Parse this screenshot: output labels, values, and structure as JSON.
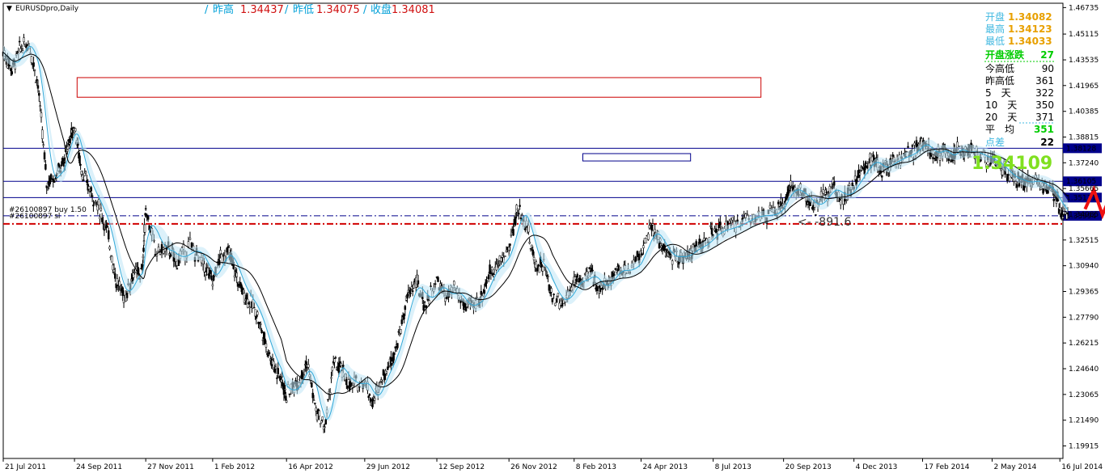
{
  "window": {
    "title": "EURUSDpro,Daily"
  },
  "header": {
    "sep": "/",
    "items": [
      {
        "label": "昨高",
        "value": "1.34437"
      },
      {
        "label": "昨低",
        "value": "1.34075"
      },
      {
        "label": "收盘",
        "value": "1.34081"
      }
    ],
    "label_color": "#00a0d8",
    "value_color": "#d01010"
  },
  "panel": {
    "ohl": [
      {
        "label": "开盘",
        "value": "1.34082"
      },
      {
        "label": "最高",
        "value": "1.34123"
      },
      {
        "label": "最低",
        "value": "1.34033"
      }
    ],
    "change": {
      "label": "开盘涨跌",
      "value": "27"
    },
    "stats": [
      {
        "label": "今高低",
        "value": "90"
      },
      {
        "label": "昨高低",
        "value": "361"
      },
      {
        "label": "5　天",
        "value": "322"
      },
      {
        "label": "10　天",
        "value": "350"
      },
      {
        "label": "20　天",
        "value": "371"
      }
    ],
    "avg": {
      "label": "平　均",
      "value": "351"
    },
    "spread": {
      "label": "点差",
      "value": "22"
    },
    "current_price": "1.34109",
    "colors": {
      "label_blue": "#40b8e0",
      "value_orange": "#e8a000",
      "green": "#00cc00",
      "current": "#80e020"
    }
  },
  "annotations": {
    "line_label_1": "#26100897 buy 1.50",
    "line_label_2": "#26100897 sl",
    "distance_text": "<- -891.6"
  },
  "chart_data": {
    "type": "candlestick",
    "symbol": "EURUSDpro",
    "timeframe": "Daily",
    "ylim": [
      1.1915,
      1.47
    ],
    "y_ticks": [
      "1.46735",
      "1.45115",
      "1.43535",
      "1.41965",
      "1.40385",
      "1.38815",
      "1.37240",
      "1.35665",
      "1.34085",
      "1.32515",
      "1.30940",
      "1.29365",
      "1.27790",
      "1.26215",
      "1.24640",
      "1.23065",
      "1.21490",
      "1.19915"
    ],
    "y_ticks_val": [
      1.46735,
      1.45115,
      1.43535,
      1.41965,
      1.40385,
      1.38815,
      1.3724,
      1.35665,
      1.34085,
      1.32515,
      1.3094,
      1.29365,
      1.2779,
      1.26215,
      1.2464,
      1.23065,
      1.2149,
      1.19915
    ],
    "x_labels": [
      "21 Jul 2011",
      "24 Sep 2011",
      "27 Nov 2011",
      "1 Feb 2012",
      "16 Apr 2012",
      "29 Jun 2012",
      "12 Sep 2012",
      "26 Nov 2012",
      "8 Feb 2013",
      "24 Apr 2013",
      "8 Jul 2013",
      "20 Sep 2013",
      "4 Dec 2013",
      "17 Feb 2014",
      "2 May 2014",
      "16 Jul 2014"
    ],
    "x_labels_pos": [
      0.0,
      0.082,
      0.164,
      0.241,
      0.326,
      0.416,
      0.499,
      0.582,
      0.657,
      0.734,
      0.817,
      0.898,
      0.979,
      1.058,
      1.138,
      1.216
    ],
    "horizontal_lines": [
      {
        "value": 1.38128,
        "label": "1.38128",
        "color": "#00008b",
        "style": "solid"
      },
      {
        "value": 1.36105,
        "label": "1.36105",
        "color": "#00008b",
        "style": "solid"
      },
      {
        "value": 1.35111,
        "label": "1.35111",
        "color": "#00008b",
        "style": "solid"
      },
      {
        "value": 1.33994,
        "label": "1.33994",
        "color": "#00008b",
        "style": "dashdot"
      },
      {
        "value": 1.335,
        "label": "",
        "color": "#d00000",
        "style": "dashdot"
      }
    ],
    "rectangles": [
      {
        "x0": 0.085,
        "x1": 0.872,
        "y0": 1.4245,
        "y1": 1.4125,
        "color": "#cc0000"
      },
      {
        "x0": 0.667,
        "x1": 0.791,
        "y0": 1.378,
        "y1": 1.3735,
        "color": "#00008b"
      }
    ],
    "price_path": [
      [
        0.0,
        1.44
      ],
      [
        0.01,
        1.43
      ],
      [
        0.02,
        1.443
      ],
      [
        0.03,
        1.445
      ],
      [
        0.04,
        1.42
      ],
      [
        0.05,
        1.36
      ],
      [
        0.06,
        1.365
      ],
      [
        0.07,
        1.372
      ],
      [
        0.075,
        1.385
      ],
      [
        0.082,
        1.395
      ],
      [
        0.09,
        1.368
      ],
      [
        0.1,
        1.355
      ],
      [
        0.11,
        1.345
      ],
      [
        0.12,
        1.33
      ],
      [
        0.13,
        1.3
      ],
      [
        0.14,
        1.29
      ],
      [
        0.15,
        1.305
      ],
      [
        0.16,
        1.305
      ],
      [
        0.164,
        1.345
      ],
      [
        0.175,
        1.318
      ],
      [
        0.19,
        1.32
      ],
      [
        0.2,
        1.312
      ],
      [
        0.215,
        1.322
      ],
      [
        0.23,
        1.31
      ],
      [
        0.241,
        1.3
      ],
      [
        0.25,
        1.315
      ],
      [
        0.26,
        1.317
      ],
      [
        0.27,
        1.3
      ],
      [
        0.28,
        1.29
      ],
      [
        0.29,
        1.283
      ],
      [
        0.3,
        1.265
      ],
      [
        0.31,
        1.25
      ],
      [
        0.32,
        1.24
      ],
      [
        0.326,
        1.23
      ],
      [
        0.34,
        1.24
      ],
      [
        0.35,
        1.25
      ],
      [
        0.36,
        1.22
      ],
      [
        0.37,
        1.21
      ],
      [
        0.38,
        1.25
      ],
      [
        0.39,
        1.245
      ],
      [
        0.4,
        1.235
      ],
      [
        0.416,
        1.24
      ],
      [
        0.425,
        1.225
      ],
      [
        0.435,
        1.24
      ],
      [
        0.445,
        1.25
      ],
      [
        0.455,
        1.265
      ],
      [
        0.465,
        1.29
      ],
      [
        0.475,
        1.3
      ],
      [
        0.485,
        1.285
      ],
      [
        0.499,
        1.3
      ],
      [
        0.51,
        1.29
      ],
      [
        0.52,
        1.295
      ],
      [
        0.53,
        1.285
      ],
      [
        0.54,
        1.285
      ],
      [
        0.55,
        1.29
      ],
      [
        0.56,
        1.305
      ],
      [
        0.57,
        1.31
      ],
      [
        0.582,
        1.32
      ],
      [
        0.592,
        1.345
      ],
      [
        0.602,
        1.335
      ],
      [
        0.612,
        1.31
      ],
      [
        0.622,
        1.31
      ],
      [
        0.632,
        1.29
      ],
      [
        0.645,
        1.287
      ],
      [
        0.657,
        1.3
      ],
      [
        0.667,
        1.3
      ],
      [
        0.677,
        1.305
      ],
      [
        0.687,
        1.295
      ],
      [
        0.697,
        1.3
      ],
      [
        0.707,
        1.308
      ],
      [
        0.717,
        1.305
      ],
      [
        0.734,
        1.318
      ],
      [
        0.745,
        1.332
      ],
      [
        0.755,
        1.325
      ],
      [
        0.765,
        1.315
      ],
      [
        0.775,
        1.315
      ],
      [
        0.785,
        1.315
      ],
      [
        0.795,
        1.32
      ],
      [
        0.805,
        1.322
      ],
      [
        0.817,
        1.33
      ],
      [
        0.83,
        1.332
      ],
      [
        0.845,
        1.335
      ],
      [
        0.86,
        1.34
      ],
      [
        0.875,
        1.34
      ],
      [
        0.89,
        1.342
      ],
      [
        0.898,
        1.347
      ],
      [
        0.905,
        1.357
      ],
      [
        0.915,
        1.355
      ],
      [
        0.925,
        1.35
      ],
      [
        0.935,
        1.345
      ],
      [
        0.945,
        1.352
      ],
      [
        0.955,
        1.358
      ],
      [
        0.965,
        1.35
      ],
      [
        0.979,
        1.36
      ],
      [
        0.99,
        1.368
      ],
      [
        1.0,
        1.375
      ],
      [
        1.01,
        1.368
      ],
      [
        1.02,
        1.372
      ],
      [
        1.03,
        1.375
      ],
      [
        1.04,
        1.377
      ],
      [
        1.05,
        1.38
      ],
      [
        1.058,
        1.385
      ],
      [
        1.066,
        1.38
      ],
      [
        1.074,
        1.378
      ],
      [
        1.082,
        1.381
      ],
      [
        1.09,
        1.375
      ],
      [
        1.098,
        1.382
      ],
      [
        1.106,
        1.378
      ],
      [
        1.115,
        1.38
      ],
      [
        1.125,
        1.376
      ],
      [
        1.138,
        1.374
      ],
      [
        1.148,
        1.37
      ],
      [
        1.158,
        1.364
      ],
      [
        1.168,
        1.362
      ],
      [
        1.178,
        1.36
      ],
      [
        1.188,
        1.362
      ],
      [
        1.198,
        1.358
      ],
      [
        1.208,
        1.355
      ],
      [
        1.216,
        1.345
      ],
      [
        1.225,
        1.341
      ]
    ],
    "projection_arrows": [
      [
        [
          1.245,
          1.344
        ],
        [
          1.255,
          1.356
        ],
        [
          1.265,
          1.3405
        ],
        [
          1.285,
          1.3655
        ],
        [
          1.305,
          1.347
        ],
        [
          1.322,
          1.3815
        ],
        [
          1.335,
          1.372
        ],
        [
          1.362,
          1.4075
        ]
      ],
      [
        [
          1.362,
          1.4075
        ],
        [
          1.498,
          1.259
        ]
      ]
    ],
    "xlabel": "",
    "ylabel": ""
  }
}
